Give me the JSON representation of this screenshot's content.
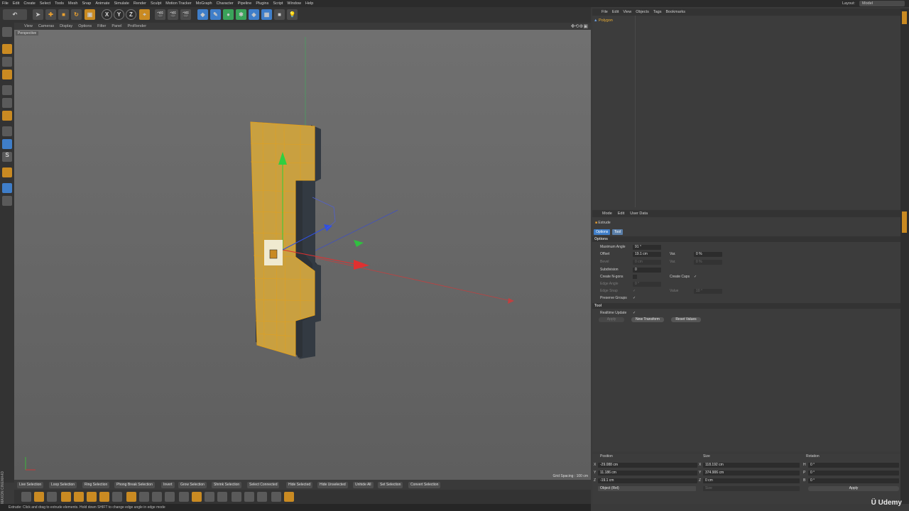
{
  "menubar": {
    "items": [
      "File",
      "Edit",
      "Create",
      "Select",
      "Tools",
      "Mesh",
      "Snap",
      "Animate",
      "Simulate",
      "Render",
      "Sculpt",
      "Motion Tracker",
      "MoGraph",
      "Character",
      "Pipeline",
      "Plugins",
      "Script",
      "Window",
      "Help"
    ],
    "layout_label": "Layout:",
    "layout_value": "Model"
  },
  "toolbar": {
    "x_label": "X",
    "y_label": "Y",
    "z_label": "Z"
  },
  "viewport": {
    "menu": [
      "View",
      "Cameras",
      "Display",
      "Options",
      "Filter",
      "Panel",
      "ProRender"
    ],
    "camera_label": "Perspective",
    "grid_spacing": "Grid Spacing : 100 cm"
  },
  "selection_bar": {
    "items": [
      "Live Selection",
      "Loop Selection",
      "Ring Selection",
      "Phong Break Selection",
      "Invert",
      "Grow Selection",
      "Shrink Selection",
      "Select Connected",
      "Hide Selected",
      "Hide Unselected",
      "Unhide All",
      "Set Selection",
      "Convert Selection"
    ]
  },
  "status": {
    "text": "Extrude: Click and drag to extrude elements. Hold down SHIFT to change edge angle in edge mode"
  },
  "branding": {
    "maxon": "MAXON CINEMA4D",
    "udemy": "Udemy"
  },
  "object_manager": {
    "menu": [
      "File",
      "Edit",
      "View",
      "Objects",
      "Tags",
      "Bookmarks"
    ],
    "object_name": "Polygon"
  },
  "attribute_manager": {
    "menu": [
      "Mode",
      "Edit",
      "User Data"
    ],
    "tool_name": "Extrude",
    "tabs": [
      "Options",
      "Tool"
    ],
    "options_header": "Options",
    "max_angle_label": "Maximum Angle",
    "max_angle_value": "91 °",
    "offset_label": "Offset",
    "offset_value": "19.1 cm",
    "var1_label": "Var.",
    "var1_value": "0 %",
    "bevel_label": "Bevel",
    "bevel_value": "0 cm",
    "var2_label": "Var.",
    "var2_value": "0 %",
    "subdivision_label": "Subdivision",
    "subdivision_value": "0",
    "create_ngons_label": "Create N-gons",
    "create_caps_label": "Create Caps",
    "create_caps_check": "✓",
    "edge_angle_label": "Edge Angle",
    "edge_angle_value": "0 °",
    "edge_snap_label": "Edge Snap",
    "edge_snap_check": "✓",
    "value_label": "Value",
    "value_value": "10 °",
    "preserve_groups_label": "Preserve Groups",
    "preserve_groups_check": "✓",
    "tool_header": "Tool",
    "realtime_label": "Realtime Update",
    "realtime_check": "✓",
    "apply_btn": "Apply",
    "new_transform_btn": "New Transform",
    "reset_values_btn": "Reset Values"
  },
  "coordinates": {
    "headers": [
      "Position",
      "Size",
      "Rotation"
    ],
    "rows": [
      {
        "pos_axis": "X",
        "pos": "-29.088 cm",
        "size_axis": "X",
        "size": "118.192 cm",
        "rot_axis": "H",
        "rot": "0 °"
      },
      {
        "pos_axis": "Y",
        "pos": "11.186 cm",
        "size_axis": "Y",
        "size": "374.906 cm",
        "rot_axis": "P",
        "rot": "0 °"
      },
      {
        "pos_axis": "Z",
        "pos": "-19.1 cm",
        "size_axis": "Z",
        "size": "0 cm",
        "rot_axis": "B",
        "rot": "0 °"
      }
    ],
    "mode_value": "Object (Rel)",
    "size_mode": "Size",
    "apply_btn": "Apply"
  },
  "colors": {
    "mesh": "#c9a040",
    "mesh_edge": "#e0a020",
    "axis_x": "#e03030",
    "axis_y": "#30c040",
    "axis_z": "#3050e0"
  }
}
